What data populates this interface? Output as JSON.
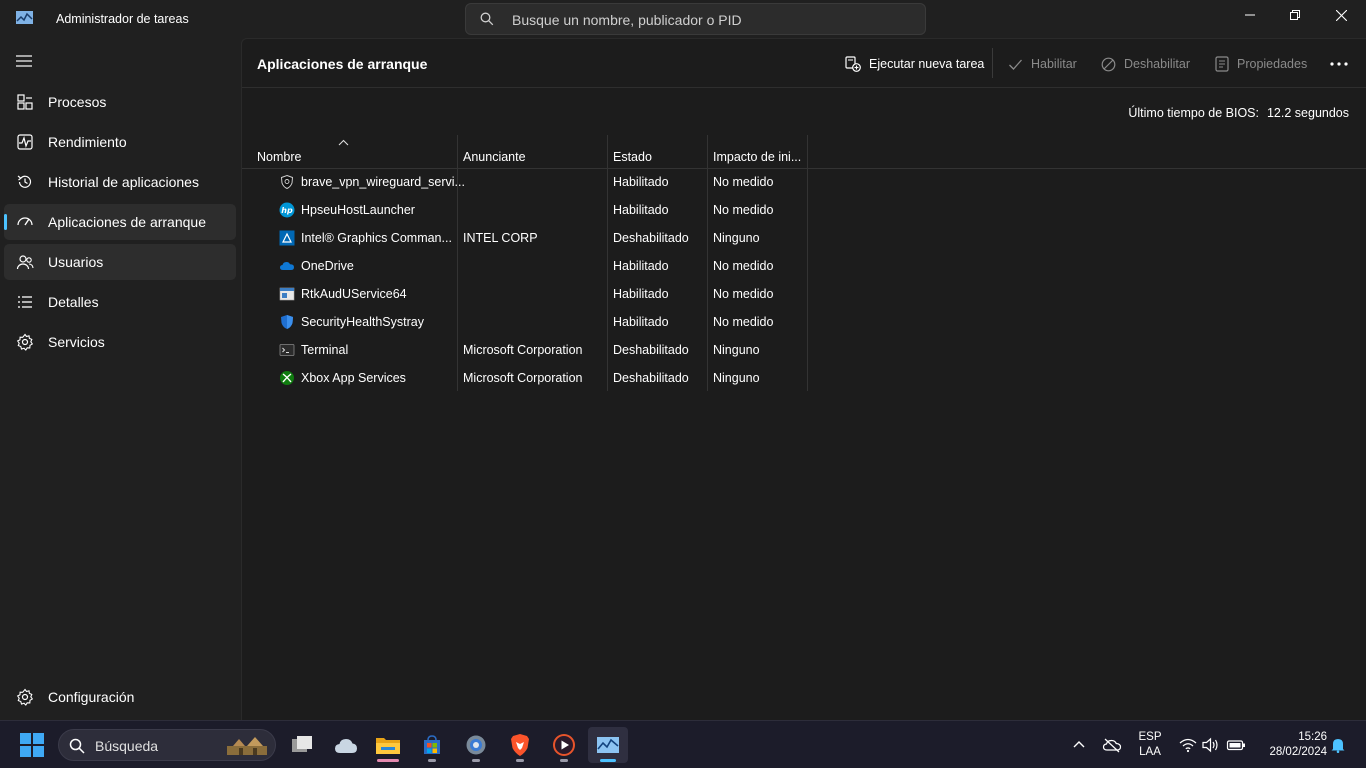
{
  "window": {
    "title": "Administrador de tareas",
    "search_placeholder": "Busque un nombre, publicador o PID"
  },
  "sidebar": {
    "items": [
      {
        "label": "Procesos",
        "icon": "processes-icon"
      },
      {
        "label": "Rendimiento",
        "icon": "performance-icon"
      },
      {
        "label": "Historial de aplicaciones",
        "icon": "history-icon"
      },
      {
        "label": "Aplicaciones de arranque",
        "icon": "startup-icon"
      },
      {
        "label": "Usuarios",
        "icon": "users-icon"
      },
      {
        "label": "Detalles",
        "icon": "details-icon"
      },
      {
        "label": "Servicios",
        "icon": "services-icon"
      }
    ],
    "settings_label": "Configuración"
  },
  "main": {
    "title": "Aplicaciones de arranque",
    "toolbar": {
      "run_new_task": "Ejecutar nueva tarea",
      "enable": "Habilitar",
      "disable": "Deshabilitar",
      "properties": "Propiedades"
    },
    "bios_label": "Último tiempo de BIOS:",
    "bios_value": "12.2 segundos",
    "columns": [
      "Nombre",
      "Anunciante",
      "Estado",
      "Impacto de ini..."
    ],
    "rows": [
      {
        "name": "brave_vpn_wireguard_servi...",
        "publisher": "",
        "status": "Habilitado",
        "impact": "No medido",
        "icon": "brave-vpn-icon"
      },
      {
        "name": "HpseuHostLauncher",
        "publisher": "",
        "status": "Habilitado",
        "impact": "No medido",
        "icon": "hp-icon"
      },
      {
        "name": "Intel® Graphics Comman...",
        "publisher": "INTEL CORP",
        "status": "Deshabilitado",
        "impact": "Ninguno",
        "icon": "intel-graphics-icon"
      },
      {
        "name": "OneDrive",
        "publisher": "",
        "status": "Habilitado",
        "impact": "No medido",
        "icon": "onedrive-icon"
      },
      {
        "name": "RtkAudUService64",
        "publisher": "",
        "status": "Habilitado",
        "impact": "No medido",
        "icon": "realtek-audio-icon"
      },
      {
        "name": "SecurityHealthSystray",
        "publisher": "",
        "status": "Habilitado",
        "impact": "No medido",
        "icon": "windows-security-icon"
      },
      {
        "name": "Terminal",
        "publisher": "Microsoft Corporation",
        "status": "Deshabilitado",
        "impact": "Ninguno",
        "icon": "terminal-icon"
      },
      {
        "name": "Xbox App Services",
        "publisher": "Microsoft Corporation",
        "status": "Deshabilitado",
        "impact": "Ninguno",
        "icon": "xbox-icon"
      }
    ]
  },
  "taskbar": {
    "search_label": "Búsqueda",
    "lang_top": "ESP",
    "lang_bottom": "LAA",
    "time": "15:26",
    "date": "28/02/2024"
  },
  "colors": {
    "accent": "#4cc2ff",
    "background": "#202020",
    "panel": "#1c1c1c"
  }
}
